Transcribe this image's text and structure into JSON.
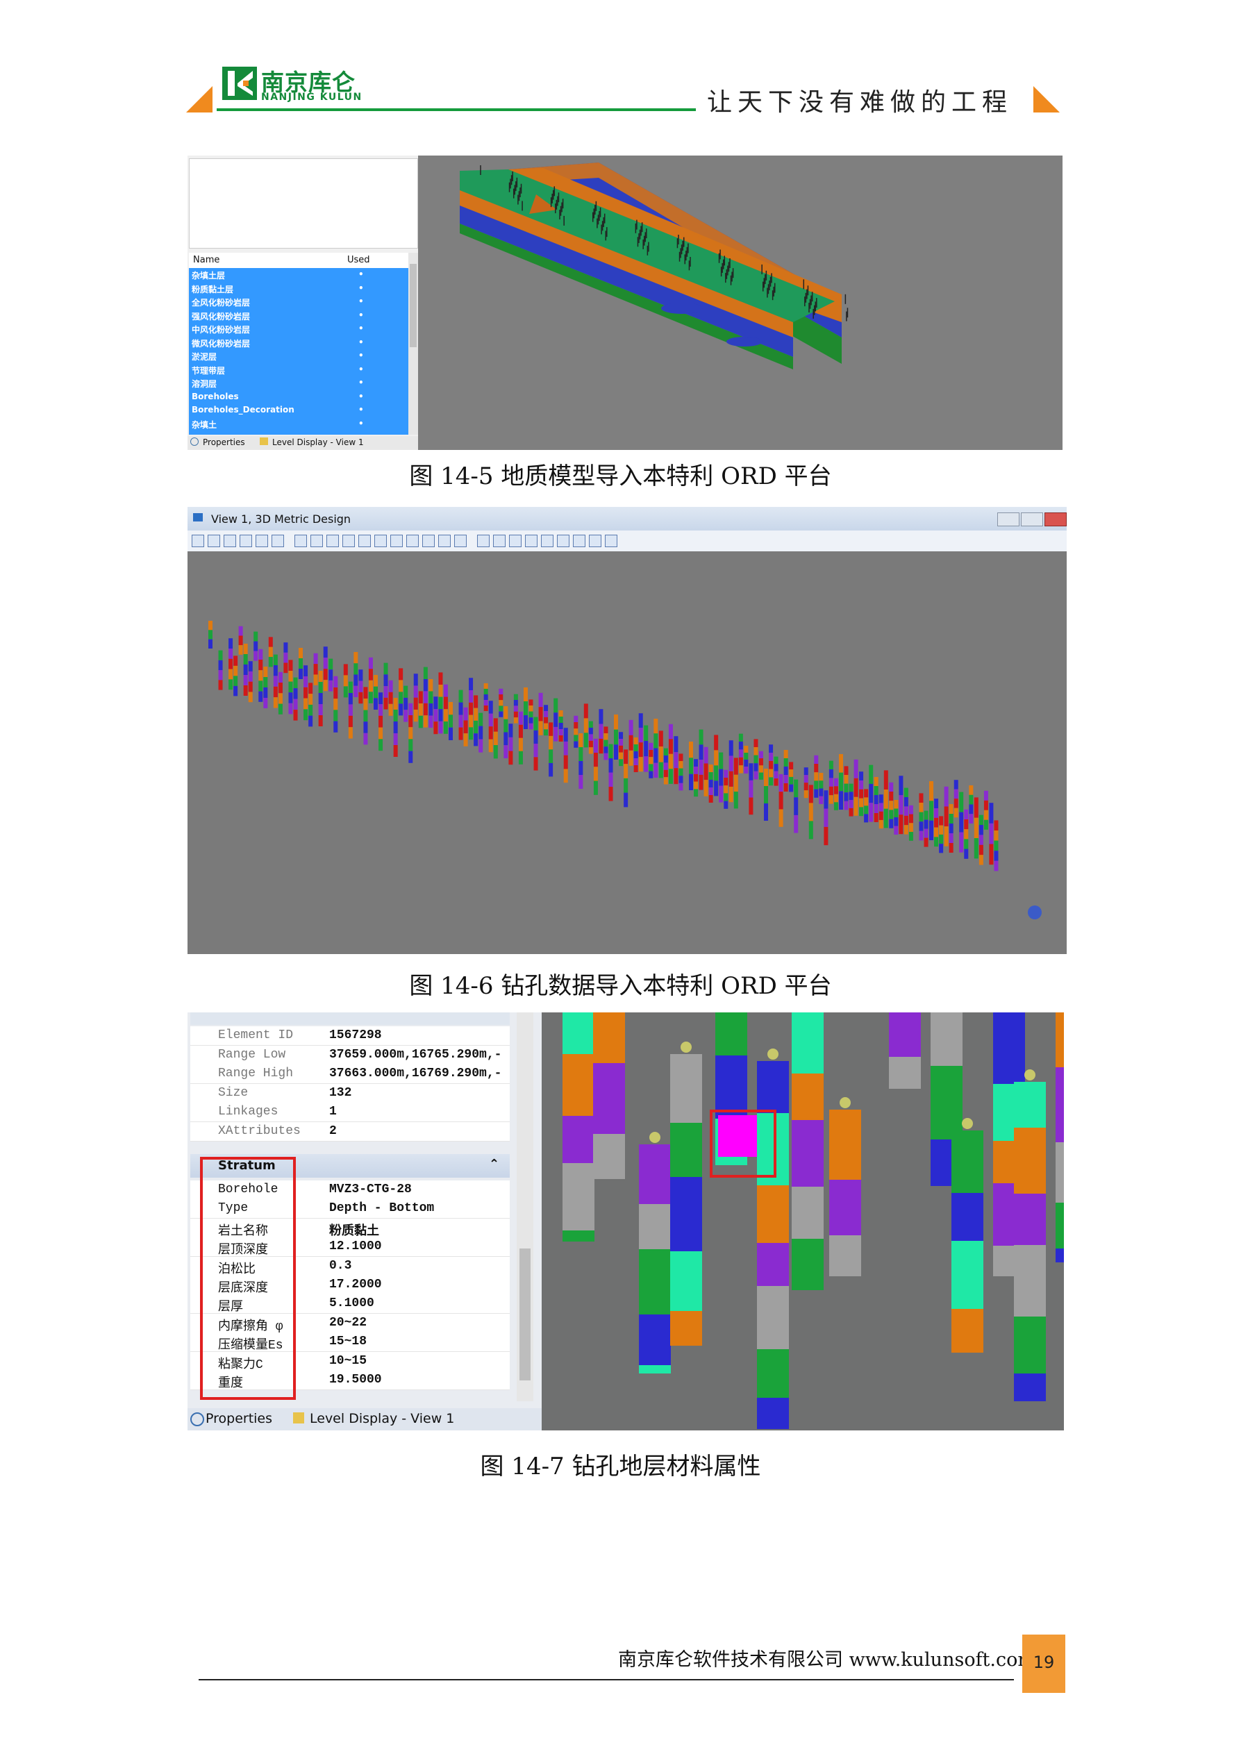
{
  "header": {
    "logo_cn": "南京库仑",
    "logo_en": "NANJING KULUN",
    "slogan": "让天下没有难做的工程"
  },
  "figure1": {
    "caption": "图 14-5  地质模型导入本特利 ORD 平台",
    "list_header_name": "Name",
    "list_header_used": "Used",
    "rows": [
      "杂填土层",
      "粉质黏土层",
      "全风化粉砂岩层",
      "强风化粉砂岩层",
      "中风化粉砂岩层",
      "微风化粉砂岩层",
      "淤泥层",
      "节理带层",
      "溶洞层",
      "Boreholes",
      "Boreholes_Decoration",
      "杂填土"
    ],
    "used_mark": "•",
    "tab_properties": "Properties",
    "tab_level": "Level Display - View 1"
  },
  "figure2": {
    "caption": "图 14-6  钻孔数据导入本特利 ORD 平台",
    "window_title": "View 1, 3D Metric Design"
  },
  "figure3": {
    "caption": "图 14-7  钻孔地层材料属性",
    "raw_rows": [
      {
        "k": "Element ID",
        "v": "1567298"
      },
      {
        "k": "Range Low",
        "v": "37659.000m,16765.290m,-"
      },
      {
        "k": "Range High",
        "v": "37663.000m,16769.290m,-"
      },
      {
        "k": "Size",
        "v": "132"
      },
      {
        "k": "Linkages",
        "v": "1"
      },
      {
        "k": "XAttributes",
        "v": "2"
      }
    ],
    "section_title": "Stratum",
    "stratum_rows": [
      {
        "k": "Borehole",
        "v": "MVZ3-CTG-28"
      },
      {
        "k": "Type",
        "v": "Depth - Bottom"
      },
      {
        "k": "岩土名称",
        "v": "粉质黏土"
      },
      {
        "k": "层顶深度",
        "v": "12.1000"
      },
      {
        "k": "泊松比",
        "v": "0.3"
      },
      {
        "k": "层底深度",
        "v": "17.2000"
      },
      {
        "k": "层厚",
        "v": "5.1000"
      },
      {
        "k": "内摩擦角 φ",
        "v": "20~22"
      },
      {
        "k": "压缩模量Es",
        "v": "15~18"
      },
      {
        "k": "粘聚力C",
        "v": "10~15"
      },
      {
        "k": "重度",
        "v": "19.5000"
      }
    ],
    "tab_properties": "Properties",
    "tab_level": "Level Display - View 1"
  },
  "footer": {
    "company": "南京库仑软件技术有限公司  www.kulunsoft.com",
    "page": "19"
  }
}
